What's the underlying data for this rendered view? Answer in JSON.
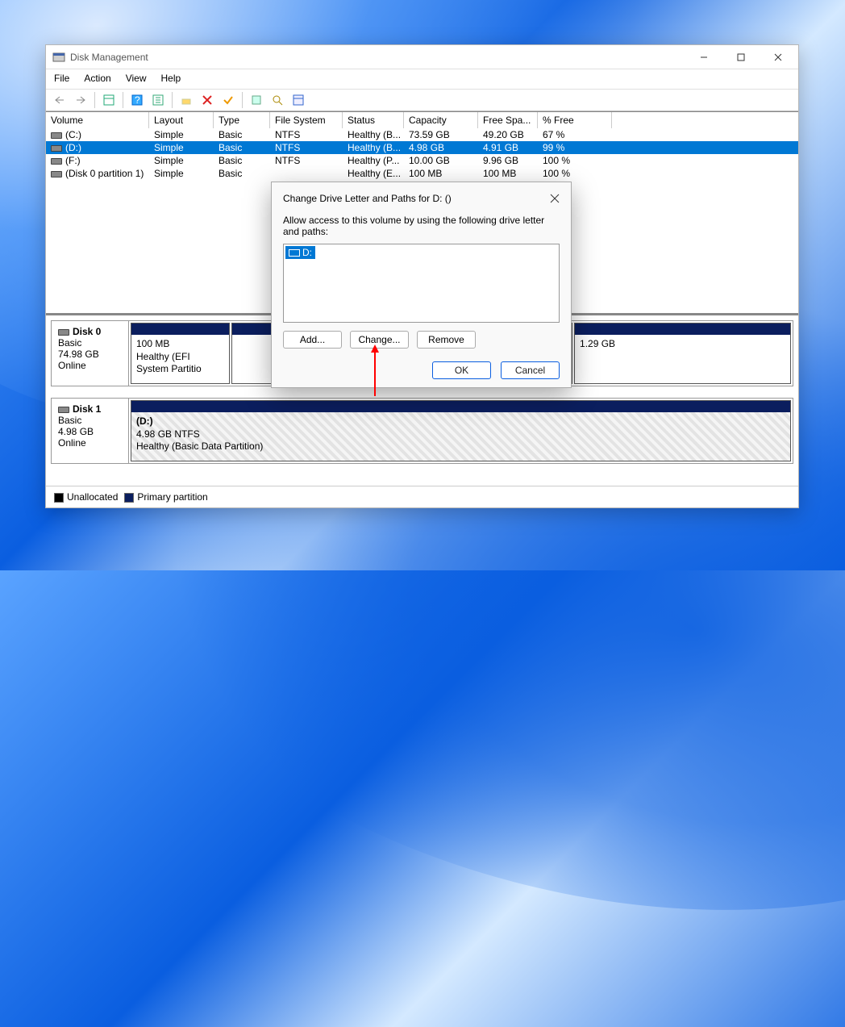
{
  "app_title": "Disk Management",
  "menus": [
    "File",
    "Action",
    "View",
    "Help"
  ],
  "columns": {
    "volume": "Volume",
    "layout": "Layout",
    "type": "Type",
    "fs": "File System",
    "status": "Status",
    "capacity": "Capacity",
    "free": "Free Spa...",
    "pct": "% Free"
  },
  "rows": [
    {
      "volume": "(C:)",
      "layout": "Simple",
      "type": "Basic",
      "fs": "NTFS",
      "status": "Healthy (B...",
      "capacity": "73.59 GB",
      "free": "49.20 GB",
      "pct": "67 %"
    },
    {
      "volume": "(D:)",
      "layout": "Simple",
      "type": "Basic",
      "fs": "NTFS",
      "status": "Healthy (B...",
      "capacity": "4.98 GB",
      "free": "4.91 GB",
      "pct": "99 %",
      "selected": true
    },
    {
      "volume": "(F:)",
      "layout": "Simple",
      "type": "Basic",
      "fs": "NTFS",
      "status": "Healthy (P...",
      "capacity": "10.00 GB",
      "free": "9.96 GB",
      "pct": "100 %"
    },
    {
      "volume": "(Disk 0 partition 1)",
      "layout": "Simple",
      "type": "Basic",
      "fs": "",
      "status": "Healthy (E...",
      "capacity": "100 MB",
      "free": "100 MB",
      "pct": "100 %"
    }
  ],
  "disks": [
    {
      "name": "Disk 0",
      "type": "Basic",
      "size": "74.98 GB",
      "state": "Online",
      "parts": [
        {
          "title": "",
          "line1": "100 MB",
          "line2": "Healthy (EFI System Partitio",
          "flex": 1.5
        },
        {
          "title": "",
          "line1": "",
          "line2": "",
          "flex": 5.2
        },
        {
          "title": "",
          "line1": "1.29 GB",
          "line2": "",
          "flex": 3.3
        }
      ]
    },
    {
      "name": "Disk 1",
      "type": "Basic",
      "size": "4.98 GB",
      "state": "Online",
      "hatch": true,
      "parts": [
        {
          "title": "(D:)",
          "line1": "4.98 GB NTFS",
          "line2": "Healthy (Basic Data Partition)",
          "flex": 1,
          "bold": true
        }
      ]
    }
  ],
  "legend": {
    "unallocated": "Unallocated",
    "primary": "Primary partition"
  },
  "dialog": {
    "title": "Change Drive Letter and Paths for D: ()",
    "message": "Allow access to this volume by using the following drive letter and paths:",
    "item": "D:",
    "buttons": {
      "add": "Add...",
      "change": "Change...",
      "remove": "Remove",
      "ok": "OK",
      "cancel": "Cancel"
    }
  }
}
